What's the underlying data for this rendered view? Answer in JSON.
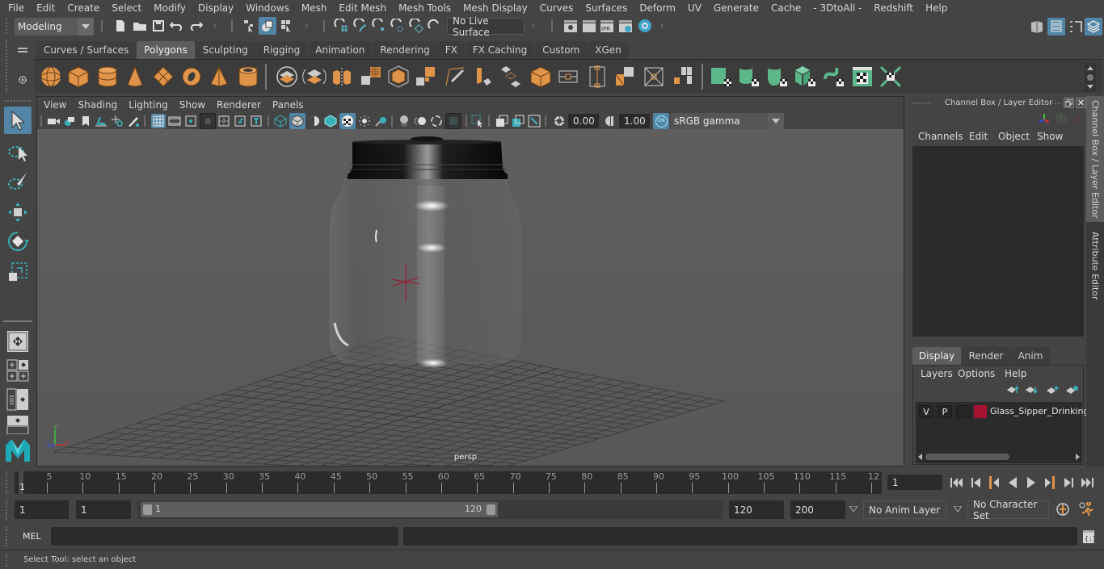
{
  "menubar": {
    "items": [
      "File",
      "Edit",
      "Create",
      "Select",
      "Modify",
      "Display",
      "Windows",
      "Mesh",
      "Edit Mesh",
      "Mesh Tools",
      "Mesh Display",
      "Curves",
      "Surfaces",
      "Deform",
      "UV",
      "Generate",
      "Cache",
      "- 3DtoAll -",
      "Redshift",
      "Help"
    ]
  },
  "statusline": {
    "workspace": "Modeling",
    "live_surface": "No Live Surface"
  },
  "shelf": {
    "tabs": [
      "Curves / Surfaces",
      "Polygons",
      "Sculpting",
      "Rigging",
      "Animation",
      "Rendering",
      "FX",
      "FX Caching",
      "Custom",
      "XGen"
    ],
    "active_tab": "Polygons"
  },
  "viewport": {
    "menu": [
      "View",
      "Shading",
      "Lighting",
      "Show",
      "Renderer",
      "Panels"
    ],
    "exposure": "0.00",
    "gamma": "1.00",
    "color_management_toggle": "ON",
    "color_space": "sRGB gamma",
    "camera_label": "persp",
    "axis": {
      "y": "y",
      "z": "z",
      "x": "x"
    }
  },
  "channel_box": {
    "title": "Channel Box / Layer Editor",
    "menu": [
      "Channels",
      "Edit",
      "Object",
      "Show"
    ]
  },
  "layer_editor": {
    "tabs": [
      "Display",
      "Render",
      "Anim"
    ],
    "active_tab": "Display",
    "menu": [
      "Layers",
      "Options",
      "Help"
    ],
    "layers": [
      {
        "visible": "V",
        "playback": "P",
        "type": "",
        "color": "#a4122f",
        "name": "Glass_Sipper_Drinking"
      }
    ]
  },
  "side_tabs": [
    "Channel Box / Layer Editor",
    "Attribute Editor"
  ],
  "timeline": {
    "start_marker": "1",
    "ticks": [
      "5",
      "10",
      "15",
      "20",
      "25",
      "30",
      "35",
      "40",
      "45",
      "50",
      "55",
      "60",
      "65",
      "70",
      "75",
      "80",
      "85",
      "90",
      "95",
      "100",
      "105",
      "110",
      "115",
      "12"
    ],
    "current_frame": "1"
  },
  "range": {
    "start": "1",
    "playback_start": "1",
    "slider_min": "1",
    "slider_max": "120",
    "playback_end": "120",
    "end": "200",
    "anim_layer": "No Anim Layer",
    "character_set": "No Character Set"
  },
  "cmdline": {
    "language": "MEL",
    "input": "",
    "result": ""
  },
  "helpline": {
    "text": "Select Tool: select an object"
  },
  "colors": {
    "accent_blue": "#5285a6",
    "poly_orange": "#e0944a",
    "uv_green": "#5cb88a",
    "layer_red": "#a4122f"
  }
}
